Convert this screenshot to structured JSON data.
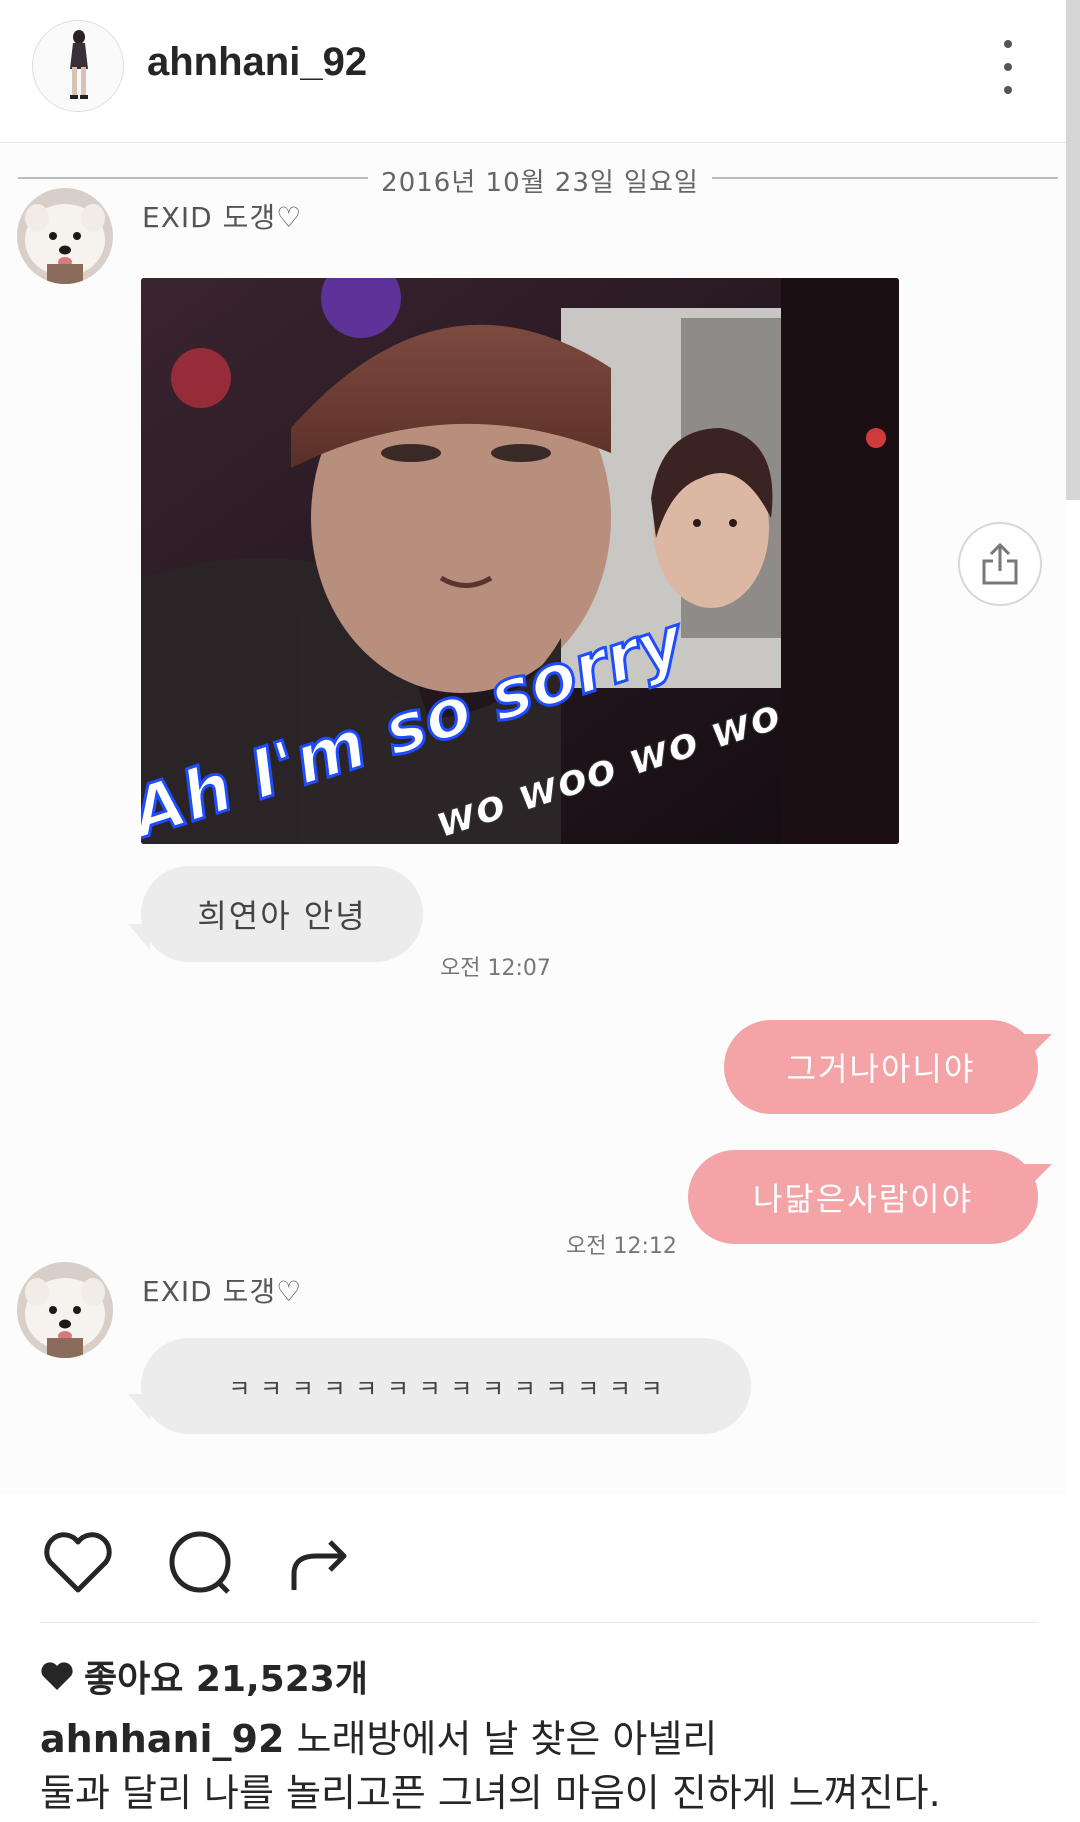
{
  "post": {
    "username": "ahnhani_92"
  },
  "chat": {
    "date": "2016년 10월 23일 일요일",
    "sender": "EXID 도갱♡",
    "photo_caption_big": "Ah I'm so sorry",
    "photo_caption_small": "wo woo wo wo",
    "messages": [
      {
        "text": "희연아 안녕",
        "time": "오전 12:07"
      },
      {
        "text": "그거나아니야"
      },
      {
        "text": "나닮은사람이야",
        "time": "오전 12:12"
      },
      {
        "text": "ㅋ ㅋ ㅋ ㅋ ㅋ ㅋ ㅋ ㅋ ㅋ ㅋ ㅋ ㅋ ㅋ ㅋ"
      }
    ]
  },
  "actions": {
    "icons": [
      "heart-icon",
      "comment-icon",
      "share-icon"
    ]
  },
  "likes": {
    "label": "좋아요 21,523개"
  },
  "caption": {
    "username": "ahnhani_92",
    "text": "노래방에서 날 찾은 아넬리\n둘과 달리 나를 놀리고픈 그녀의 마음이 진하게 느껴진다."
  },
  "colors": {
    "outgoing_bubble": "#f4a3a6",
    "incoming_bubble": "#ececec"
  }
}
